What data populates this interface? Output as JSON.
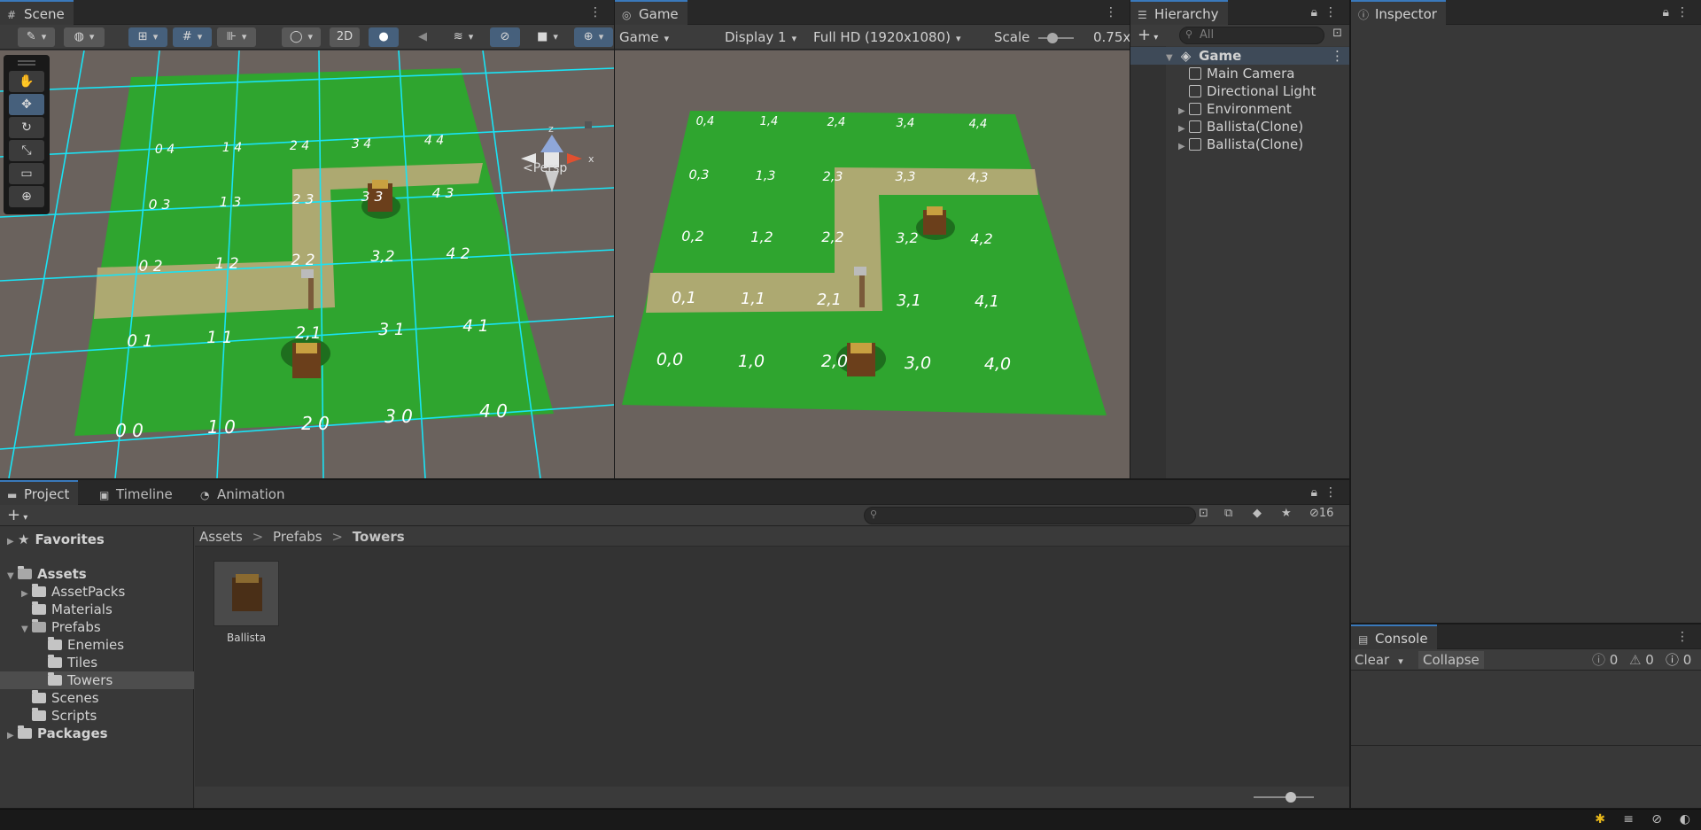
{
  "scene": {
    "tab_label": "Scene",
    "btn_2d": "2D",
    "persp_label": "Persp",
    "gizmo_axes": {
      "x": "x",
      "z": "z"
    },
    "grid_labels": [
      {
        "text": "0 4"
      },
      {
        "text": "1 4"
      },
      {
        "text": "2 4"
      },
      {
        "text": "3 4"
      },
      {
        "text": "4 4"
      },
      {
        "text": "0 3"
      },
      {
        "text": "1 3"
      },
      {
        "text": "2 3"
      },
      {
        "text": "3 3"
      },
      {
        "text": "4 3"
      },
      {
        "text": "0 2"
      },
      {
        "text": "1 2"
      },
      {
        "text": "2 2"
      },
      {
        "text": "3,2"
      },
      {
        "text": "4 2"
      },
      {
        "text": "0 1"
      },
      {
        "text": "1 1"
      },
      {
        "text": "2,1"
      },
      {
        "text": "3 1"
      },
      {
        "text": "4 1"
      },
      {
        "text": "0 0"
      },
      {
        "text": "1 0"
      },
      {
        "text": "2 0"
      },
      {
        "text": "3 0"
      },
      {
        "text": "4 0"
      }
    ]
  },
  "game": {
    "tab_label": "Game",
    "mode_dropdown": "Game",
    "display_dropdown": "Display 1",
    "resolution_dropdown": "Full HD (1920x1080)",
    "scale_label": "Scale",
    "scale_value": "0.75x",
    "grid_labels": [
      {
        "text": "0,4"
      },
      {
        "text": "1,4"
      },
      {
        "text": "2,4"
      },
      {
        "text": "3,4"
      },
      {
        "text": "4,4"
      },
      {
        "text": "0,3"
      },
      {
        "text": "1,3"
      },
      {
        "text": "2,3"
      },
      {
        "text": "3,3"
      },
      {
        "text": "4,3"
      },
      {
        "text": "0,2"
      },
      {
        "text": "1,2"
      },
      {
        "text": "2,2"
      },
      {
        "text": "3,2"
      },
      {
        "text": "4,2"
      },
      {
        "text": "0,1"
      },
      {
        "text": "1,1"
      },
      {
        "text": "2,1"
      },
      {
        "text": "3,1"
      },
      {
        "text": "4,1"
      },
      {
        "text": "0,0"
      },
      {
        "text": "1,0"
      },
      {
        "text": "2,0"
      },
      {
        "text": "3,0"
      },
      {
        "text": "4,0"
      }
    ]
  },
  "hierarchy": {
    "tab_label": "Hierarchy",
    "search_placeholder": "All",
    "scene_name": "Game",
    "items": [
      {
        "label": "Main Camera",
        "expandable": false
      },
      {
        "label": "Directional Light",
        "expandable": false
      },
      {
        "label": "Environment",
        "expandable": true
      },
      {
        "label": "Ballista(Clone)",
        "expandable": true
      },
      {
        "label": "Ballista(Clone)",
        "expandable": true
      }
    ]
  },
  "inspector": {
    "tab_label": "Inspector"
  },
  "project": {
    "tabs": [
      {
        "label": "Project",
        "icon": "folder-icon"
      },
      {
        "label": "Timeline",
        "icon": "timeline-icon"
      },
      {
        "label": "Animation",
        "icon": "animation-icon"
      }
    ],
    "hidden_count": "16",
    "breadcrumb": [
      "Assets",
      "Prefabs",
      "Towers"
    ],
    "tree": [
      {
        "label": "Favorites",
        "bold": true
      },
      {
        "label": "Assets",
        "bold": true
      },
      {
        "label": "AssetPacks"
      },
      {
        "label": "Materials"
      },
      {
        "label": "Prefabs"
      },
      {
        "label": "Enemies"
      },
      {
        "label": "Tiles"
      },
      {
        "label": "Towers"
      },
      {
        "label": "Scenes"
      },
      {
        "label": "Scripts"
      },
      {
        "label": "Packages",
        "bold": true
      }
    ],
    "assets": [
      {
        "label": "Ballista"
      }
    ]
  },
  "console": {
    "tab_label": "Console",
    "clear_label": "Clear",
    "collapse_label": "Collapse",
    "info_count": "0",
    "warning_count": "0",
    "error_count": "0"
  },
  "colors": {
    "grass": "#2fa52f",
    "path": "#b8a977",
    "grid_line": "#19e3f5",
    "accent": "#3a79bb",
    "ground": "#6a625d"
  }
}
